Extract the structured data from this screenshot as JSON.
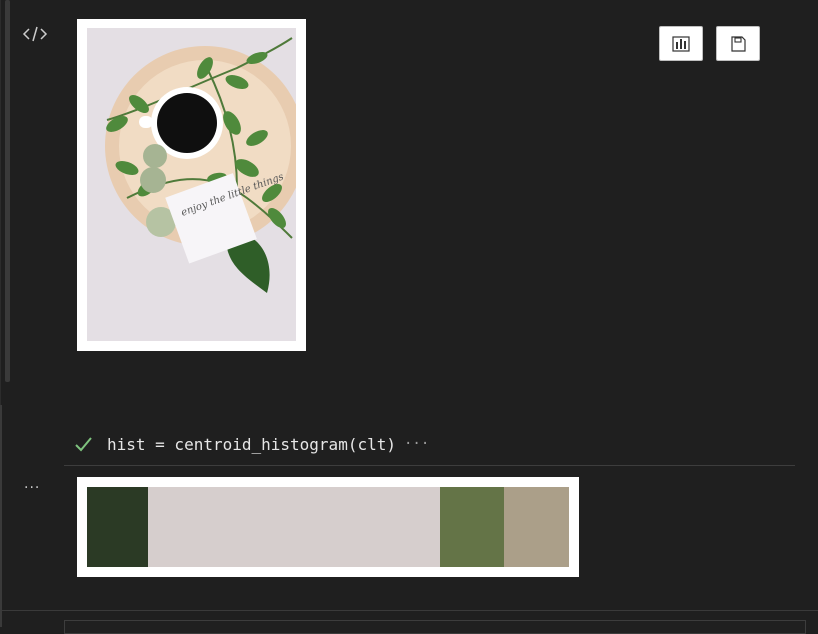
{
  "output": {
    "image_alt": "flat lay photo with coffee cup and leaves",
    "note_text": "enjoy the little things"
  },
  "toolbar": {
    "chart_icon": "bar-chart-icon",
    "save_icon": "save-icon"
  },
  "cell": {
    "status_icon": "checkmark-icon",
    "code": "hist = centroid_histogram(clt)",
    "more": "···",
    "output_more": "···"
  },
  "histogram": {
    "segments": [
      {
        "color": "#2b3a25",
        "fraction": 0.127
      },
      {
        "color": "#d6cecd",
        "fraction": 0.606
      },
      {
        "color": "#647447",
        "fraction": 0.133
      },
      {
        "color": "#ab9f89",
        "fraction": 0.134
      }
    ]
  },
  "colors": {
    "background": "#1f1f1f",
    "check_green": "#7ec37e"
  }
}
